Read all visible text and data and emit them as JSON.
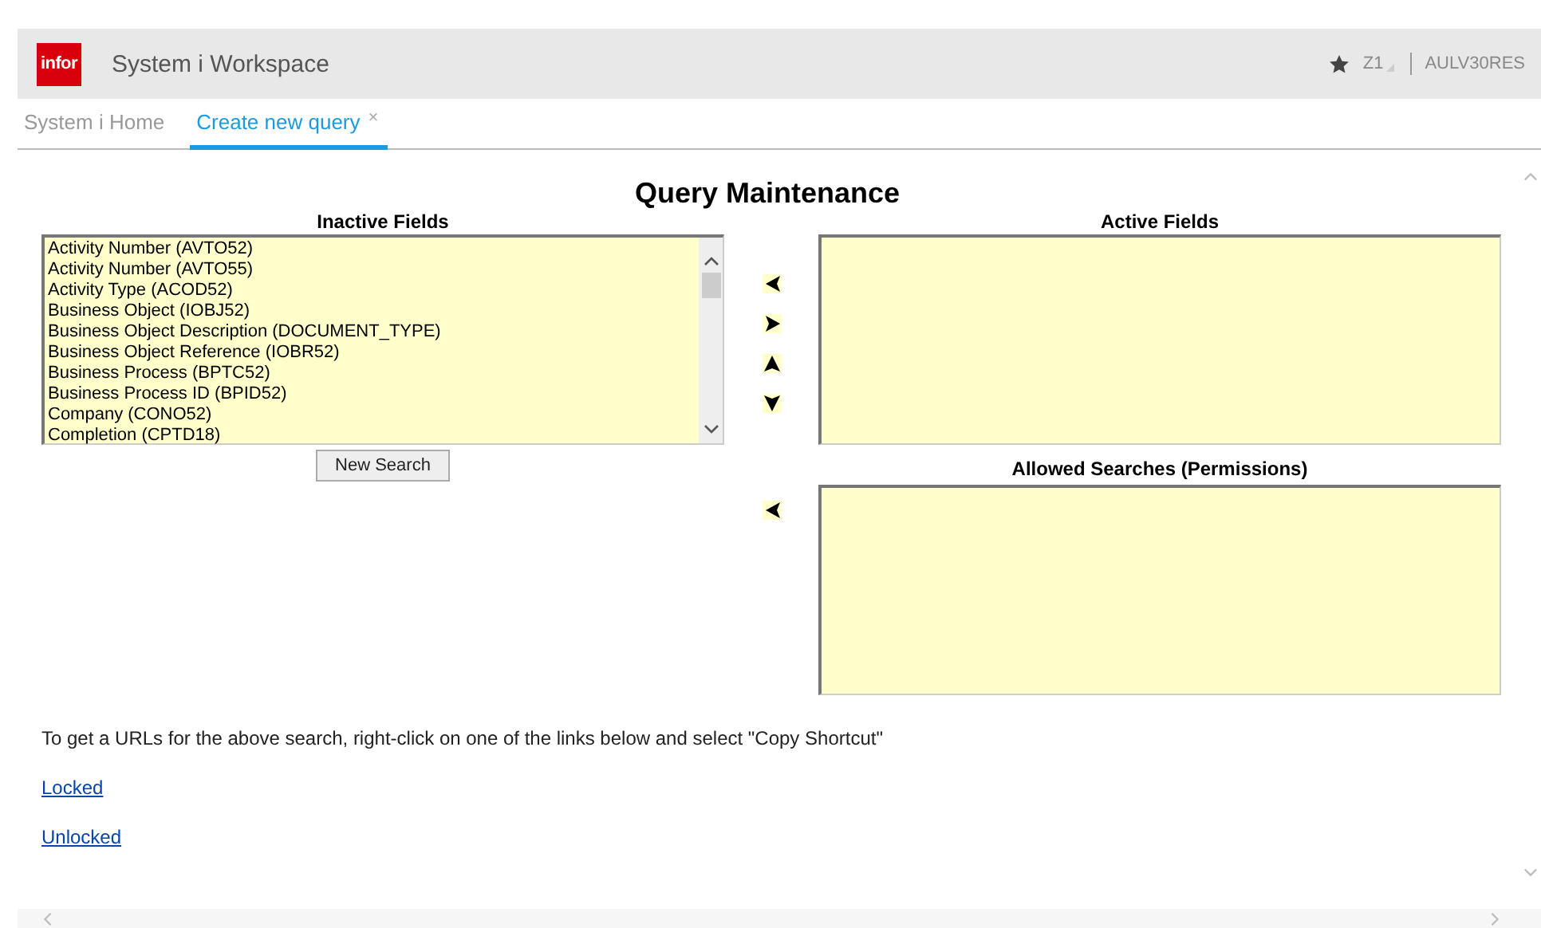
{
  "header": {
    "logo": "infor",
    "title": "System i Workspace",
    "user_menu": "Z1",
    "server_menu": "AULV30RES"
  },
  "tabs": [
    {
      "label": "System i Home",
      "selected": false
    },
    {
      "label": "Create new query",
      "selected": true,
      "close": "×"
    }
  ],
  "page_title": "Query Maintenance",
  "inactive_fields": {
    "heading": "Inactive Fields",
    "items": [
      "Activity Number (AVTO52)",
      "Activity Number (AVTO55)",
      "Activity Type (ACOD52)",
      "Business Object (IOBJ52)",
      "Business Object Description (DOCUMENT_TYPE)",
      "Business Object Reference (IOBR52)",
      "Business Process (BPTC52)",
      "Business Process ID (BPID52)",
      "Company (CONO52)",
      "Completion (CPTD18)"
    ]
  },
  "new_search_button": "New Search",
  "active_fields": {
    "heading": "Active Fields"
  },
  "allowed_searches": {
    "heading": "Allowed Searches (Permissions)"
  },
  "shortcut_note": "To get a URLs for the above search, right-click on one of the links below and select \"Copy Shortcut\"",
  "links": [
    "Locked",
    "Unlocked"
  ]
}
